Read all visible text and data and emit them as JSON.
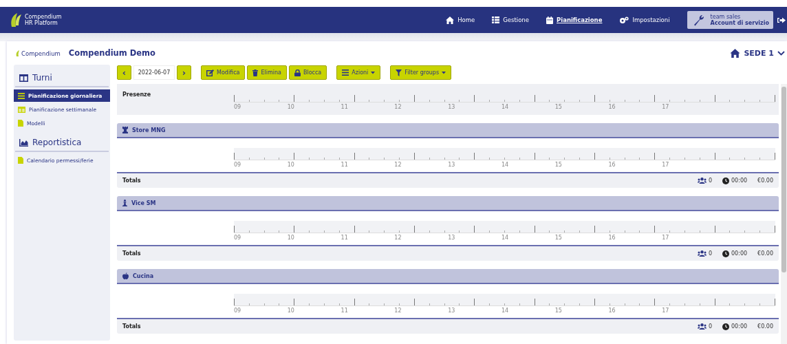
{
  "brand": {
    "line1": "Compendium",
    "line2": "HR Platform"
  },
  "nav": [
    {
      "label": "Home",
      "selected": false
    },
    {
      "label": "Gestione",
      "selected": false
    },
    {
      "label": "Pianificazione",
      "selected": true
    },
    {
      "label": "Impostazioni",
      "selected": false
    }
  ],
  "account": {
    "team": "team sales",
    "name": "Account di servizio"
  },
  "header": {
    "logo": "Compendium",
    "title": "Compendium Demo",
    "site": "SEDE 1"
  },
  "sidebar": [
    {
      "title": "Turni",
      "items": [
        {
          "label": "Pianificazione giornaliera",
          "selected": true
        },
        {
          "label": "Pianificazione settimanale",
          "selected": false
        },
        {
          "label": "Modelli",
          "selected": false
        }
      ]
    },
    {
      "title": "Reportistica",
      "items": [
        {
          "label": "Calendario permessi/ferie",
          "selected": false
        }
      ]
    }
  ],
  "toolbar": {
    "date": "2022-06-07",
    "prev": "‹",
    "next": "›",
    "actions": [
      "Modifica",
      "Elimina",
      "Blocca"
    ],
    "menus": [
      "Azioni",
      "Filter groups"
    ]
  },
  "presence": {
    "title": "Presenze",
    "hours": [
      "09",
      "10",
      "11",
      "12",
      "13",
      "14",
      "15",
      "16",
      "17"
    ]
  },
  "groups": [
    {
      "name": "Store MNG",
      "hours": [
        "09",
        "10",
        "11",
        "12",
        "13",
        "14",
        "15",
        "16",
        "17"
      ],
      "totals": {
        "label": "Totals",
        "people": "0",
        "time": "00:00",
        "cost": "€0.00"
      }
    },
    {
      "name": "Vice SM",
      "hours": [
        "09",
        "10",
        "11",
        "12",
        "13",
        "14",
        "15",
        "16",
        "17"
      ],
      "totals": {
        "label": "Totals",
        "people": "0",
        "time": "00:00",
        "cost": "€0.00"
      }
    },
    {
      "name": "Cucina",
      "hours": [
        "09",
        "10",
        "11",
        "12",
        "13",
        "14",
        "15",
        "16",
        "17"
      ],
      "totals": {
        "label": "Totals",
        "people": "0",
        "time": "00:00",
        "cost": "€0.00"
      }
    }
  ]
}
